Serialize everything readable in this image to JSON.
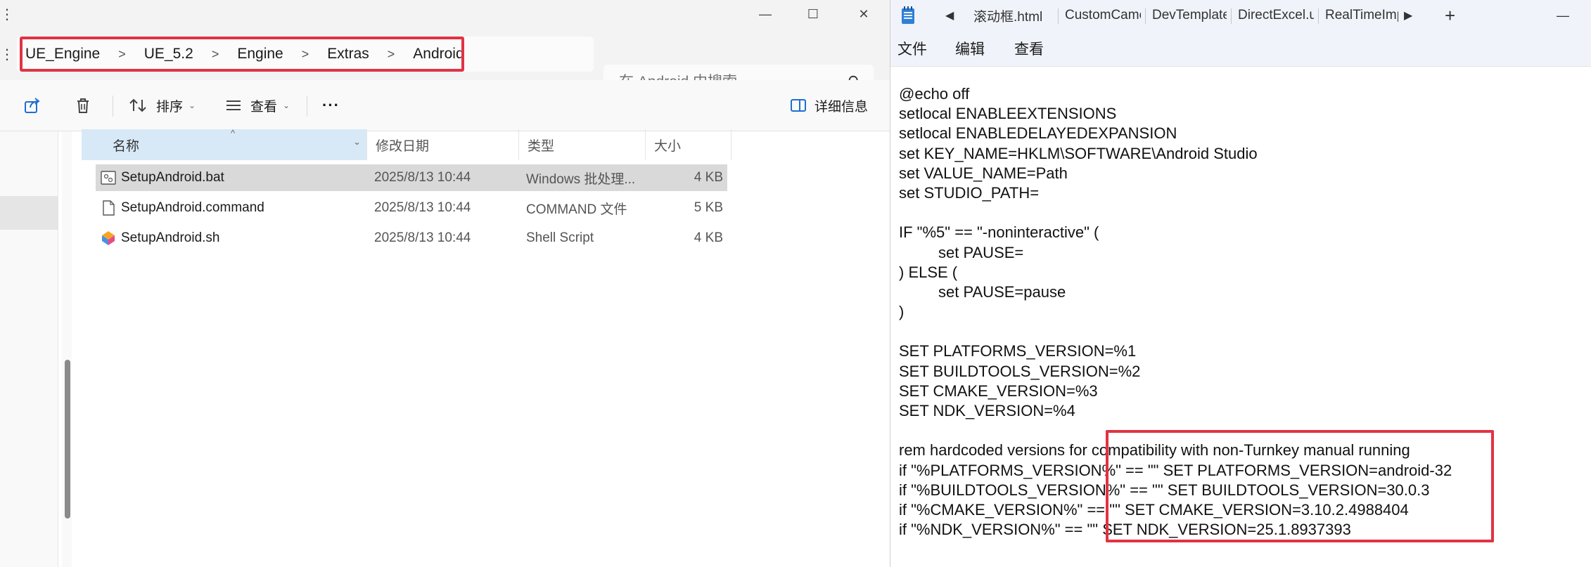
{
  "explorer": {
    "caption_buttons": {
      "minimize": "—",
      "maximize": "☐",
      "close": "✕"
    },
    "breadcrumb": [
      "UE_Engine",
      "UE_5.2",
      "Engine",
      "Extras",
      "Android"
    ],
    "breadcrumb_separator": ">",
    "search_placeholder": "在 Android 中搜索",
    "toolbar": {
      "sort_label": "排序",
      "view_label": "查看",
      "more_label": "···",
      "details_label": "详细信息"
    },
    "columns": [
      "名称",
      "修改日期",
      "类型",
      "大小"
    ],
    "files": [
      {
        "name": "SetupAndroid.bat",
        "date": "2025/8/13 10:44",
        "type": "Windows 批处理...",
        "size": "4 KB",
        "icon": "batch-file-icon",
        "selected": true
      },
      {
        "name": "SetupAndroid.command",
        "date": "2025/8/13 10:44",
        "type": "COMMAND 文件",
        "size": "5 KB",
        "icon": "generic-file-icon",
        "selected": false
      },
      {
        "name": "SetupAndroid.sh",
        "date": "2025/8/13 10:44",
        "type": "Shell Script",
        "size": "4 KB",
        "icon": "shell-script-icon",
        "selected": false
      }
    ]
  },
  "notepad": {
    "tabs": [
      "滚动框.html",
      "CustomCame",
      "DevTemplate",
      "DirectExcel.u",
      "RealTimeImp"
    ],
    "new_tab_label": "+",
    "menu": [
      "文件",
      "编辑",
      "查看"
    ],
    "lines": [
      "@echo off",
      "setlocal ENABLEEXTENSIONS",
      "setlocal ENABLEDELAYEDEXPANSION",
      "set KEY_NAME=HKLM\\SOFTWARE\\Android Studio",
      "set VALUE_NAME=Path",
      "set STUDIO_PATH=",
      "",
      "IF \"%5\" == \"-noninteractive\" (",
      "\tset PAUSE=",
      ") ELSE (",
      "\tset PAUSE=pause",
      ")",
      "",
      "SET PLATFORMS_VERSION=%1",
      "SET BUILDTOOLS_VERSION=%2",
      "SET CMAKE_VERSION=%3",
      "SET NDK_VERSION=%4",
      "",
      "rem hardcoded versions for compatibility with non-Turnkey manual running",
      "if \"%PLATFORMS_VERSION%\" == \"\" SET PLATFORMS_VERSION=android-32",
      "if \"%BUILDTOOLS_VERSION%\" == \"\" SET BUILDTOOLS_VERSION=30.0.3",
      "if \"%CMAKE_VERSION%\" == \"\" SET CMAKE_VERSION=3.10.2.4988404",
      "if \"%NDK_VERSION%\" == \"\" SET NDK_VERSION=25.1.8937393"
    ]
  },
  "colors": {
    "highlight": "#e03344",
    "header_selected": "#d7e9f7",
    "row_selected": "#d9d9d9",
    "accent": "#1f6fd1"
  }
}
